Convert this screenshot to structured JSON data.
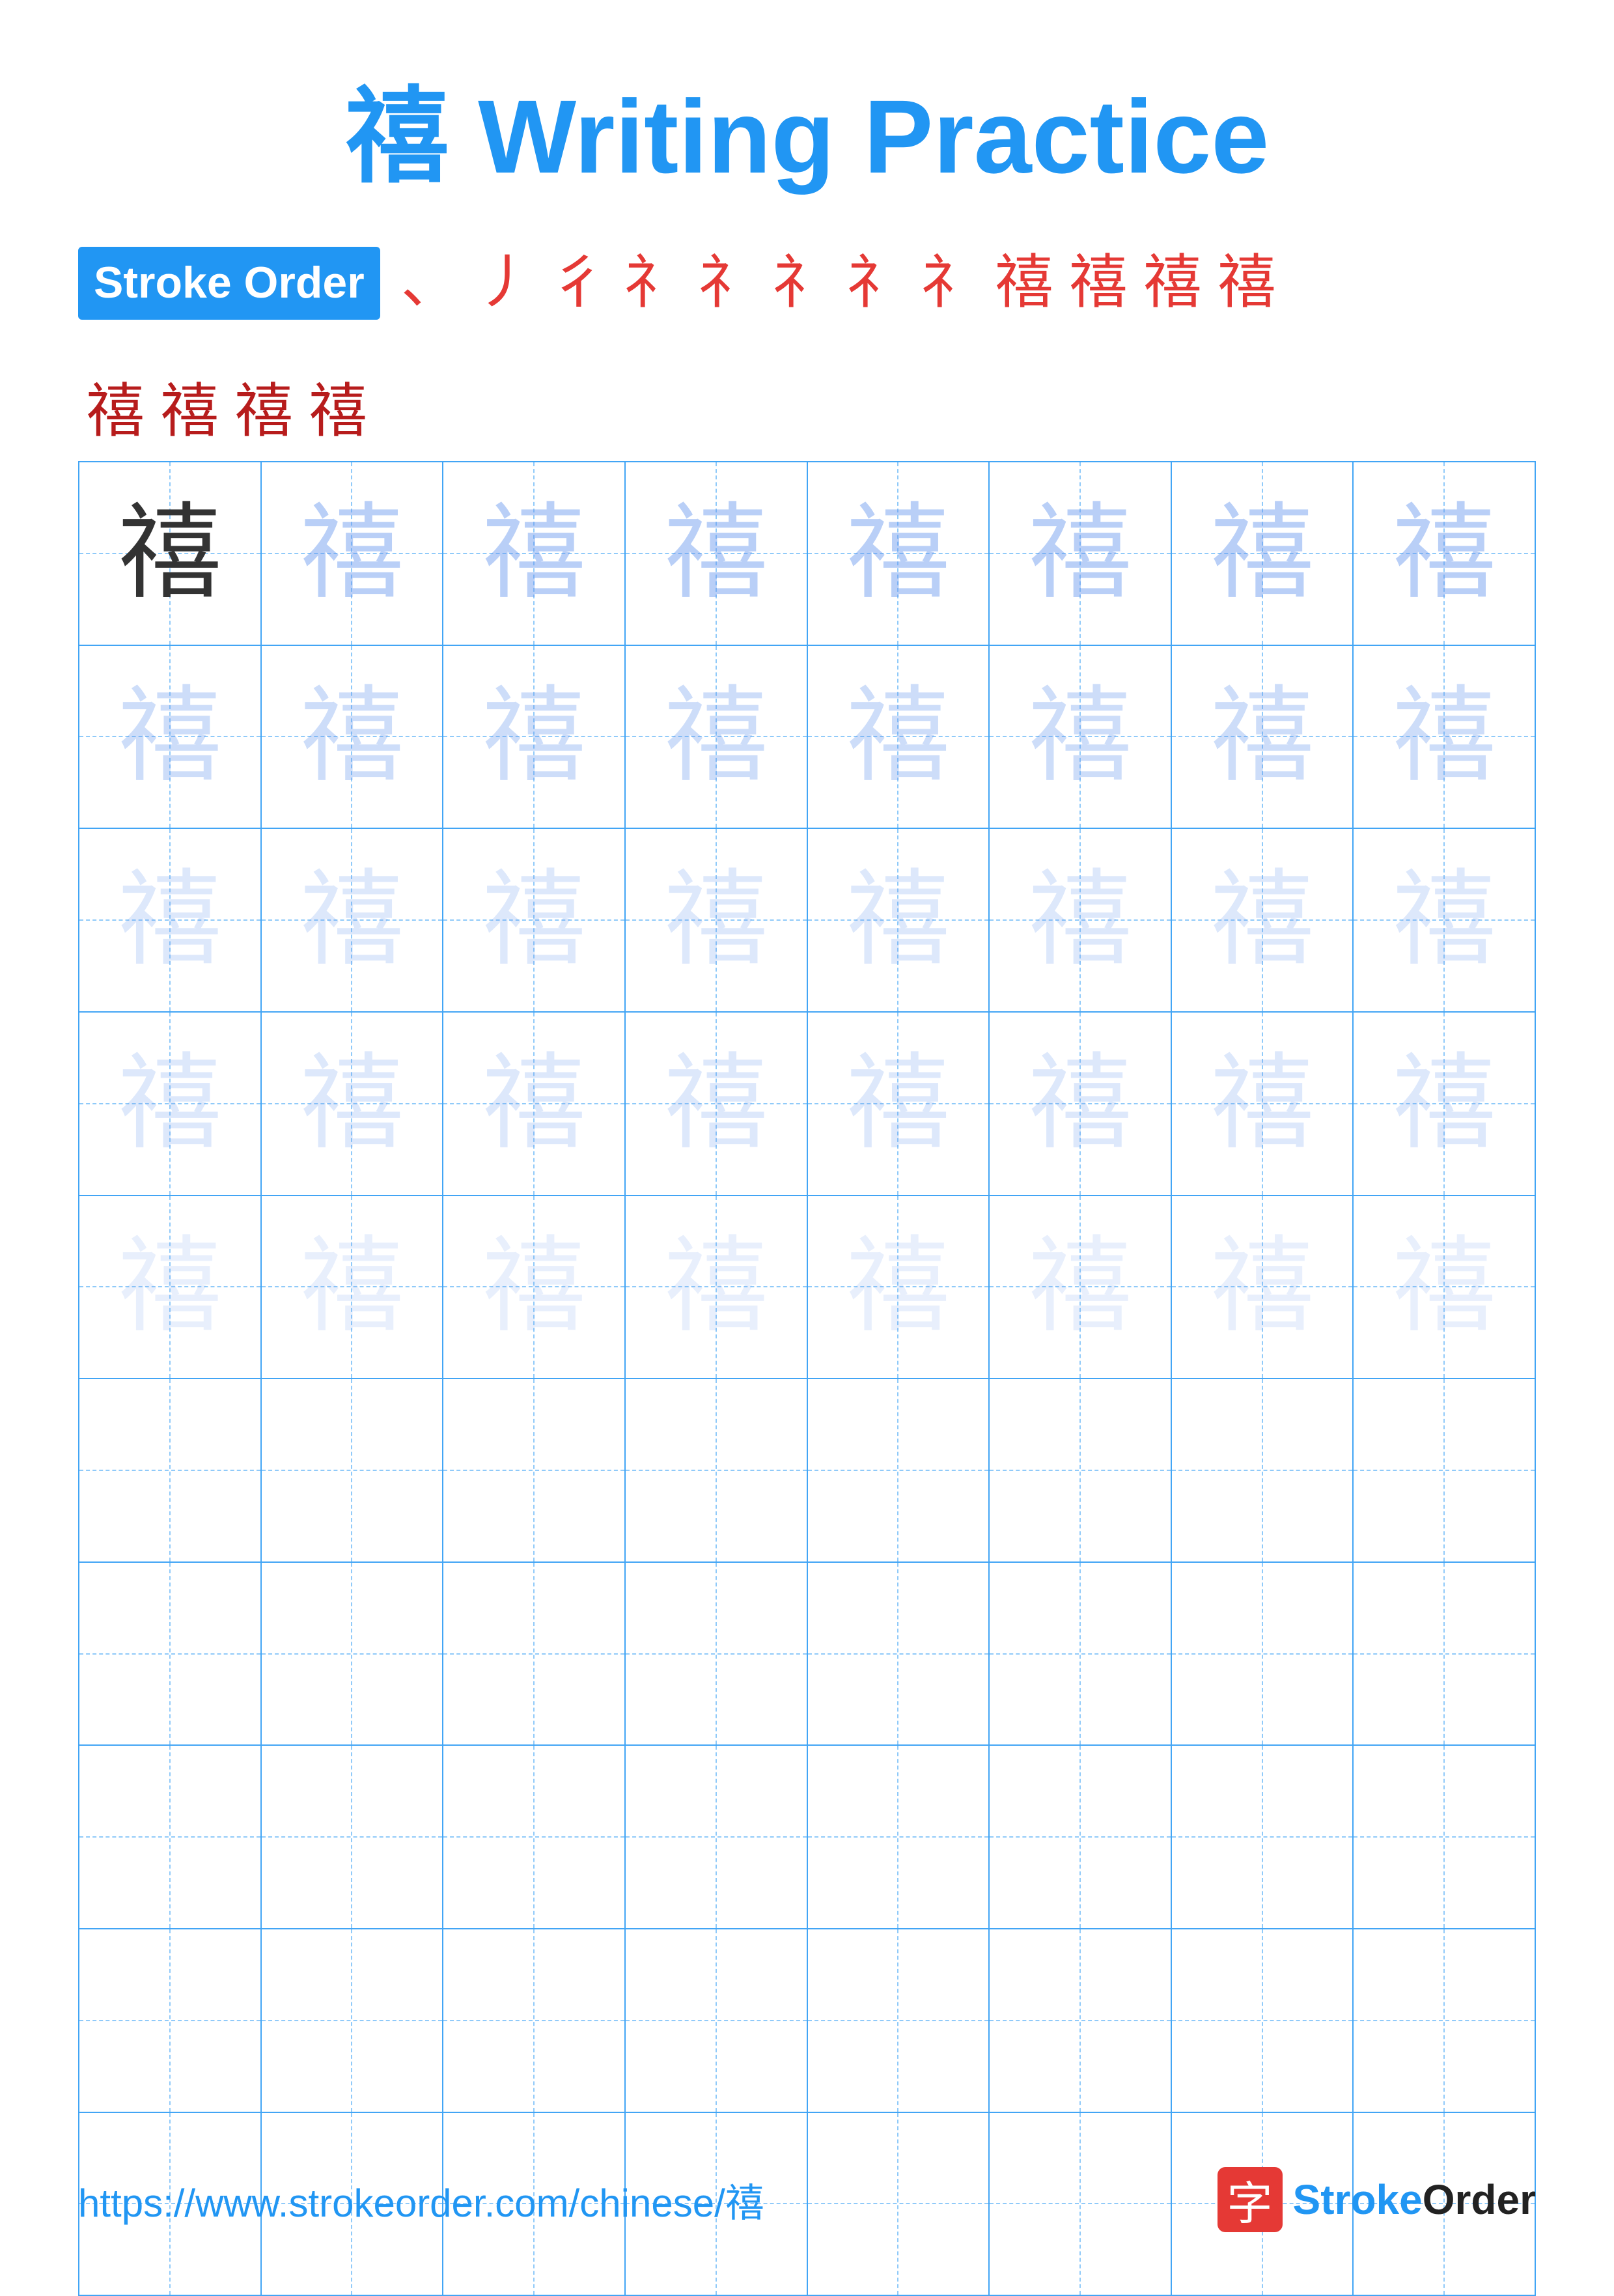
{
  "title": "禧 Writing Practice",
  "strokeOrder": {
    "label": "Stroke Order",
    "chars": [
      "`",
      "丿",
      "彳",
      "礻",
      "礻",
      "礻",
      "礻",
      "礻",
      "禧",
      "禧",
      "禧",
      "禧",
      "禧",
      "禧",
      "禧",
      "禧"
    ]
  },
  "character": "禧",
  "grid": {
    "rows": 10,
    "cols": 8
  },
  "footer": {
    "url": "https://www.strokeorder.com/chinese/禧",
    "logoChar": "字",
    "logoText": "StrokeOrder"
  }
}
